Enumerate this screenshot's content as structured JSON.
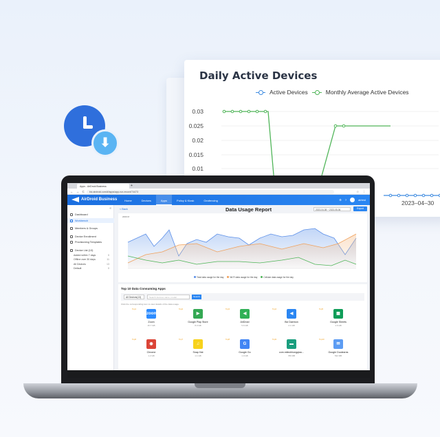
{
  "background_chart": {
    "title": "Daily Active Devices",
    "legend": [
      "Active Devices",
      "Monthly Average Active Devices"
    ],
    "y_ticks": [
      "0.03",
      "0.025",
      "0.02",
      "0.015",
      "0.01"
    ],
    "date_label": "2023–04–30",
    "colors": {
      "active": "#3d8be0",
      "monthly": "#4fb558"
    }
  },
  "browser": {
    "tab_title": "Apps - AirDroid Business",
    "url": "biz.airdroid.com/#/apps/app-run-record/74473",
    "nav_icons": "← → C ⌂",
    "ext_icons": "☆ ⋮"
  },
  "app": {
    "brand": "AirDroid Business",
    "nav": [
      {
        "label": "Home"
      },
      {
        "label": "Devices"
      },
      {
        "label": "Apps"
      },
      {
        "label": "Policy & Kiosk"
      },
      {
        "label": "Geofencing"
      }
    ],
    "user": "airtest"
  },
  "sidebar": {
    "items": [
      {
        "label": "Dashboard"
      },
      {
        "label": "Workbench"
      },
      {
        "label": "Members & Groups"
      },
      {
        "label": "Device Enrollment"
      },
      {
        "label": "Provisioning Templates"
      },
      {
        "label": "Device List (13)"
      }
    ],
    "subs": [
      {
        "label": "Added within 7 days",
        "count": "0"
      },
      {
        "label": "Offline over 30 days",
        "count": "11"
      },
      {
        "label": "All Devices",
        "count": "13"
      },
      {
        "label": "Default",
        "count": "0"
      }
    ]
  },
  "report": {
    "back": "< Back",
    "title": "Data Usage Report",
    "date_range": "2023-04-08 ~ 2023-05-06",
    "export": "Export",
    "chart_label": "2000 M",
    "legend": [
      {
        "label": "Total data usage for the day",
        "color": "#5b8fe8"
      },
      {
        "label": "Wi-Fi data usage for the day",
        "color": "#f0a05a"
      },
      {
        "label": "Cellular data usage for the day",
        "color": "#4fb558"
      }
    ]
  },
  "top_apps": {
    "title": "Top 10 Data Consuming Apps",
    "select": "All Devices(13)",
    "search_placeholder": "Search devices name, model",
    "search_btn": "Search",
    "hint": "Click the corresponding icon to view details of the data usage.",
    "apps": [
      {
        "rank": "Top1",
        "name": "Zoom",
        "size": "15.7 GB",
        "color": "#2d8cff",
        "glyph": "zoom"
      },
      {
        "rank": "Top2",
        "name": "Google Play Store",
        "size": "8.3 GB",
        "color": "#34a853",
        "glyph": "▶"
      },
      {
        "rank": "Top3",
        "name": "AirDroid",
        "size": "5.6 GB",
        "color": "#31b057",
        "glyph": "◀"
      },
      {
        "rank": "Top4",
        "name": "Biz Daemon",
        "size": "2.1 GB",
        "color": "#2a86f2",
        "glyph": "◀"
      },
      {
        "rank": "Top5",
        "name": "Google Sheets",
        "size": "1.6 GB",
        "color": "#0f9d58",
        "glyph": "▦"
      },
      {
        "rank": "Top6",
        "name": "Chrome",
        "size": "1.2 GB",
        "color": "#db4437",
        "glyph": "◉"
      },
      {
        "rank": "Top7",
        "name": "Snap Hat",
        "size": "1.1 GB",
        "color": "#f7d21c",
        "glyph": "♫"
      },
      {
        "rank": "Top8",
        "name": "Google Go",
        "size": "1.0 GB",
        "color": "#4285f4",
        "glyph": "G"
      },
      {
        "rank": "Top9",
        "name": "com.mitechhongqiao...",
        "size": "780 MB",
        "color": "#1a9e7e",
        "glyph": "▬"
      },
      {
        "rank": "Top10",
        "name": "Google Duolearns",
        "size": "532 MB",
        "color": "#5c9cf3",
        "glyph": "✉"
      }
    ]
  }
}
